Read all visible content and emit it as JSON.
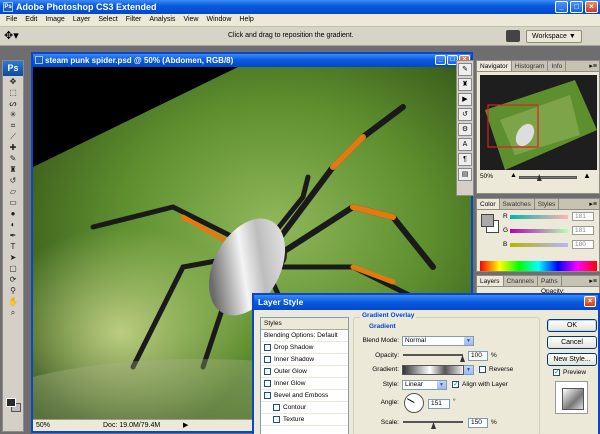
{
  "window": {
    "title": "Adobe Photoshop CS3 Extended",
    "app_icon": "Ps"
  },
  "menu": [
    "File",
    "Edit",
    "Image",
    "Layer",
    "Select",
    "Filter",
    "Analysis",
    "View",
    "Window",
    "Help"
  ],
  "options_bar": {
    "hint": "Click and drag to reposition the gradient.",
    "workspace_label": "Workspace ▼"
  },
  "toolbox": {
    "logo": "Ps"
  },
  "document": {
    "title": "steam punk spider.psd @ 50% (Abdomen, RGB/8)",
    "zoom": "50%",
    "doc_size": "Doc: 19.0M/79.4M"
  },
  "navigator": {
    "tabs": [
      "Navigator",
      "Histogram",
      "Info"
    ],
    "zoom": "50%",
    "zoom_fraction": 0.35
  },
  "color_panel": {
    "tabs": [
      "Color",
      "Swatches",
      "Styles"
    ],
    "channels": [
      {
        "label": "R",
        "value": "181"
      },
      {
        "label": "G",
        "value": "181"
      },
      {
        "label": "B",
        "value": "180"
      }
    ]
  },
  "layers_panel": {
    "tabs": [
      "Layers",
      "Channels",
      "Paths"
    ],
    "opacity_label": "Opacity:"
  },
  "dialog": {
    "title": "Layer Style",
    "styles_header": "Styles",
    "styles": [
      {
        "label": "Blending Options: Default",
        "checkbox": false,
        "checked": false,
        "sub": false
      },
      {
        "label": "Drop Shadow",
        "checkbox": true,
        "checked": false,
        "sub": false
      },
      {
        "label": "Inner Shadow",
        "checkbox": true,
        "checked": false,
        "sub": false
      },
      {
        "label": "Outer Glow",
        "checkbox": true,
        "checked": false,
        "sub": false
      },
      {
        "label": "Inner Glow",
        "checkbox": true,
        "checked": false,
        "sub": false
      },
      {
        "label": "Bevel and Emboss",
        "checkbox": true,
        "checked": false,
        "sub": false
      },
      {
        "label": "Contour",
        "checkbox": true,
        "checked": false,
        "sub": true
      },
      {
        "label": "Texture",
        "checkbox": true,
        "checked": false,
        "sub": true
      }
    ],
    "section_title": "Gradient Overlay",
    "subsection_title": "Gradient",
    "blend_mode_label": "Blend Mode:",
    "blend_mode_value": "Normal",
    "opacity_label": "Opacity:",
    "opacity_value": "100",
    "percent": "%",
    "gradient_label": "Gradient:",
    "reverse_label": "Reverse",
    "reverse_checked": false,
    "style_label": "Style:",
    "style_value": "Linear",
    "align_label": "Align with Layer",
    "align_checked": true,
    "angle_label": "Angle:",
    "angle_value": "151",
    "degree": "°",
    "scale_label": "Scale:",
    "scale_value": "150",
    "buttons": {
      "ok": "OK",
      "cancel": "Cancel",
      "new_style": "New Style..."
    },
    "preview_label": "Preview",
    "preview_checked": true
  }
}
